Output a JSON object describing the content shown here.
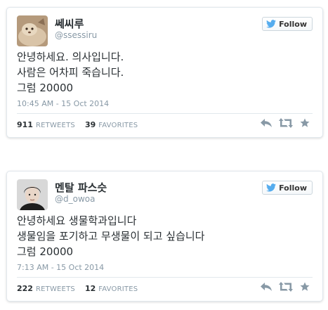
{
  "tweets": [
    {
      "display_name": "쎄씨루",
      "handle": "@ssessiru",
      "follow_label": "Follow",
      "text_lines": [
        "안녕하세요. 의사입니다.",
        "사람은 어차피 죽습니다.",
        "그럼 20000"
      ],
      "timestamp": "10:45 AM - 15 Oct 2014",
      "retweets": "911",
      "retweets_label": "RETWEETS",
      "favorites": "39",
      "favorites_label": "FAVORITES"
    },
    {
      "display_name": "멘탈 파스슷",
      "handle": "@d_owoa",
      "follow_label": "Follow",
      "text_lines": [
        "안녕하세요 생물학과입니다",
        "생물임을 포기하고 무생물이 되고 싶습니다",
        "그럼 20000"
      ],
      "timestamp": "7:13 AM - 15 Oct 2014",
      "retweets": "222",
      "retweets_label": "RETWEETS",
      "favorites": "12",
      "favorites_label": "FAVORITES"
    }
  ],
  "icons": {
    "follow": "twitter-bird-icon",
    "reply": "reply-icon",
    "retweet": "retweet-icon",
    "favorite": "star-icon"
  },
  "colors": {
    "twitter_blue": "#55acee",
    "icon_gray": "#8899a6",
    "text": "#292f33",
    "border": "#e1e8ed"
  }
}
